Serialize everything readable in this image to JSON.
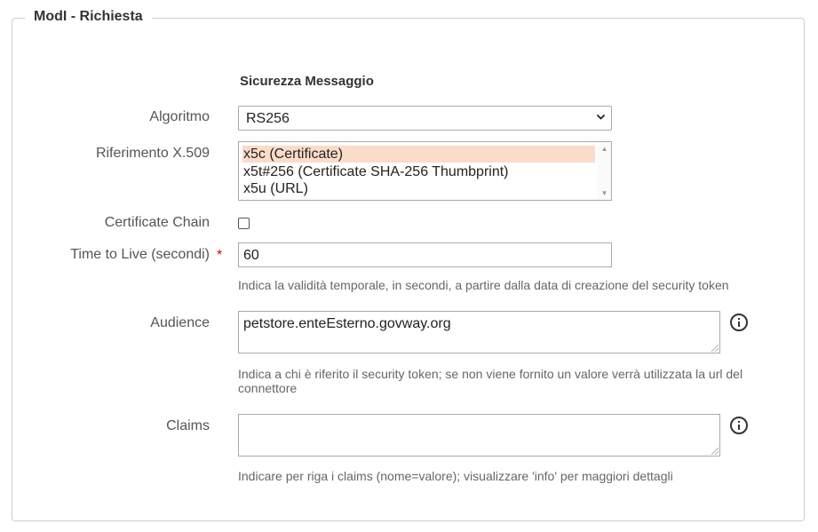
{
  "legend": "ModI - Richiesta",
  "section_title": "Sicurezza Messaggio",
  "fields": {
    "algoritmo": {
      "label": "Algoritmo",
      "value": "RS256"
    },
    "riferimento": {
      "label": "Riferimento X.509",
      "options": [
        "x5c (Certificate)",
        "x5t#256 (Certificate SHA-256 Thumbprint)",
        "x5u (URL)"
      ],
      "selected": "x5c (Certificate)"
    },
    "certificate_chain": {
      "label": "Certificate Chain",
      "checked": false
    },
    "ttl": {
      "label": "Time to Live (secondi)",
      "required_marker": "*",
      "value": "60",
      "hint": "Indica la validità temporale, in secondi, a partire dalla data di creazione del security token"
    },
    "audience": {
      "label": "Audience",
      "value": "petstore.enteEsterno.govway.org",
      "hint_line1": "Indica a chi è riferito il security token; se non viene fornito un valore verrà utilizzata la url del",
      "hint_line2": "connettore"
    },
    "claims": {
      "label": "Claims",
      "value": "",
      "hint": "Indicare per riga i claims (nome=valore); visualizzare 'info' per maggiori dettagli"
    }
  },
  "icons": {
    "info": "info-circle-icon",
    "select_arrow": "chevron-down-icon"
  },
  "colors": {
    "required": "#d0021b",
    "selected_option": "#fbdcc8"
  }
}
